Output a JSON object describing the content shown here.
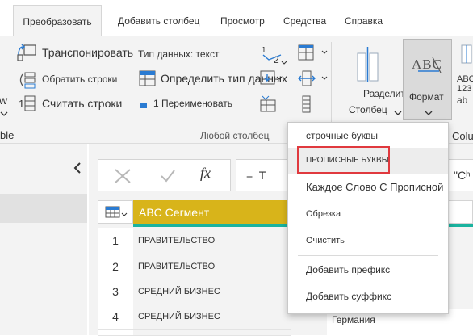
{
  "tabs": [
    "Преобразовать",
    "Добавить столбец",
    "Просмотр",
    "Средства",
    "Справка"
  ],
  "ribbon": {
    "cut_left_items": [
      "w",
      "ble"
    ],
    "transform_table": {
      "transpose": "Транспонировать",
      "reverse_rows": "Обратить строки",
      "count_rows": "Считать строки"
    },
    "any_column": {
      "data_type": "Тип данных: текст",
      "detect_type": "Определить тип данных",
      "rename": "1 Переименовать",
      "group_label": "Любой столбец"
    },
    "text_column": {
      "split": "Разделить",
      "split_sub": "Столбец",
      "format": "Формат",
      "format_icon_text": "ABC",
      "group_label_cut": "Colu",
      "small_icon_text": "ABC",
      "small_icon_sub": "123",
      "small_ab": "ab"
    }
  },
  "formula_bar": {
    "fx_symbol": "fx",
    "text_cut_left": "=  T",
    "text_cut_right": "\"Cʰ"
  },
  "grid": {
    "column_header": "ABC Сегмент",
    "rows": [
      {
        "num": "1",
        "segment": "ПРАВИТЕЛЬСТВО",
        "extra": ""
      },
      {
        "num": "2",
        "segment": "ПРАВИТЕЛЬСТВО",
        "extra": ""
      },
      {
        "num": "3",
        "segment": "СРЕДНИЙ БИЗНЕС",
        "extra": ""
      },
      {
        "num": "4",
        "segment": "СРЕДНИЙ БИЗНЕС",
        "extra": ""
      },
      {
        "num": "",
        "segment": "",
        "extra": "Германия"
      }
    ]
  },
  "menu": {
    "items": [
      {
        "label": "строчные буквы"
      },
      {
        "label": "ПРОПИСНЫЕ БУКВЫ",
        "highlighted": true
      },
      {
        "label": "Каждое Слово С Прописной"
      },
      {
        "label": "Обрезка"
      },
      {
        "label": "Очистить"
      },
      {
        "label": "Добавить префикс"
      },
      {
        "label": "Добавить суффикс"
      }
    ]
  },
  "colors": {
    "accent_header": "#d8b41a",
    "teal_bar": "#1ab39f",
    "highlight_border": "#e0393e"
  }
}
